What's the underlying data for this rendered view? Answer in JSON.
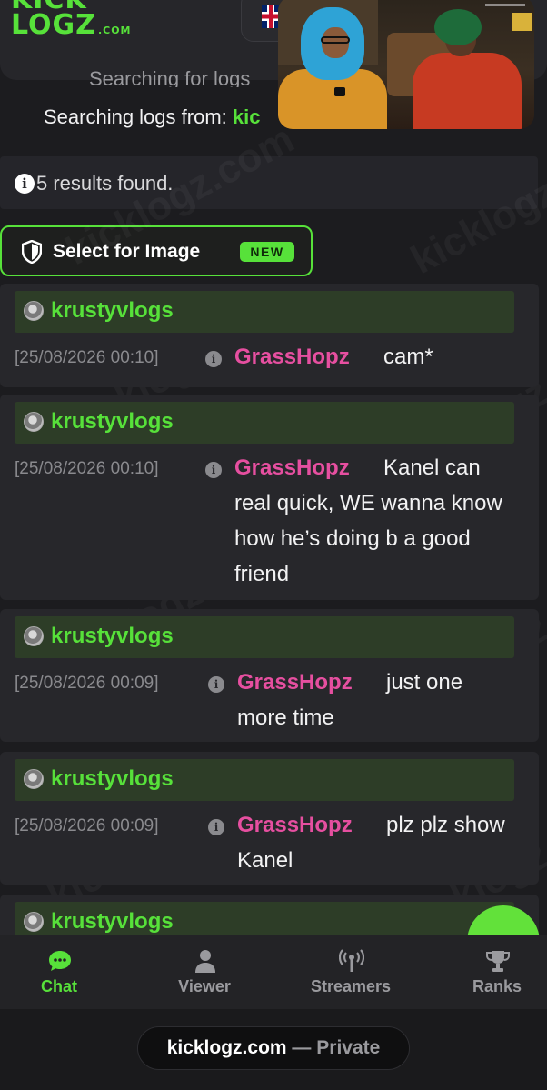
{
  "header": {
    "logo_top": "KICK",
    "logo_bottom": "LOGZ",
    "logo_suffix": ".COM",
    "status_partial": "Searching for logs",
    "status_label": "Searching logs from:",
    "status_stream": "kic"
  },
  "results": {
    "text": "5 results found."
  },
  "select_image": {
    "label": "Select for Image",
    "badge": "NEW"
  },
  "messages": [
    {
      "channel": "krustyvlogs",
      "timestamp": "[25/08/2026 00:10]",
      "user": "GrassHopz",
      "text": "cam*"
    },
    {
      "channel": "krustyvlogs",
      "timestamp": "[25/08/2026 00:10]",
      "user": "GrassHopz",
      "text": "Kanel can real quick, WE wanna know how he’s doing b a good friend"
    },
    {
      "channel": "krustyvlogs",
      "timestamp": "[25/08/2026 00:09]",
      "user": "GrassHopz",
      "text": "just one more time"
    },
    {
      "channel": "krustyvlogs",
      "timestamp": "[25/08/2026 00:09]",
      "user": "GrassHopz",
      "text": "plz plz show Kanel"
    },
    {
      "channel": "krustyvlogs"
    }
  ],
  "nav": [
    {
      "label": "Chat",
      "icon": "chat-icon",
      "active": true
    },
    {
      "label": "Viewer",
      "icon": "user-icon",
      "active": false
    },
    {
      "label": "Streamers",
      "icon": "antenna-icon",
      "active": false
    },
    {
      "label": "Ranks",
      "icon": "trophy-icon",
      "active": false
    }
  ],
  "footer": {
    "domain": "kicklogz.com",
    "separator": "—",
    "visibility": "Private"
  },
  "watermark": "kicklogz.com",
  "colors": {
    "accent": "#57e13a",
    "username": "#e64fa0",
    "background": "#1c1c1f"
  }
}
